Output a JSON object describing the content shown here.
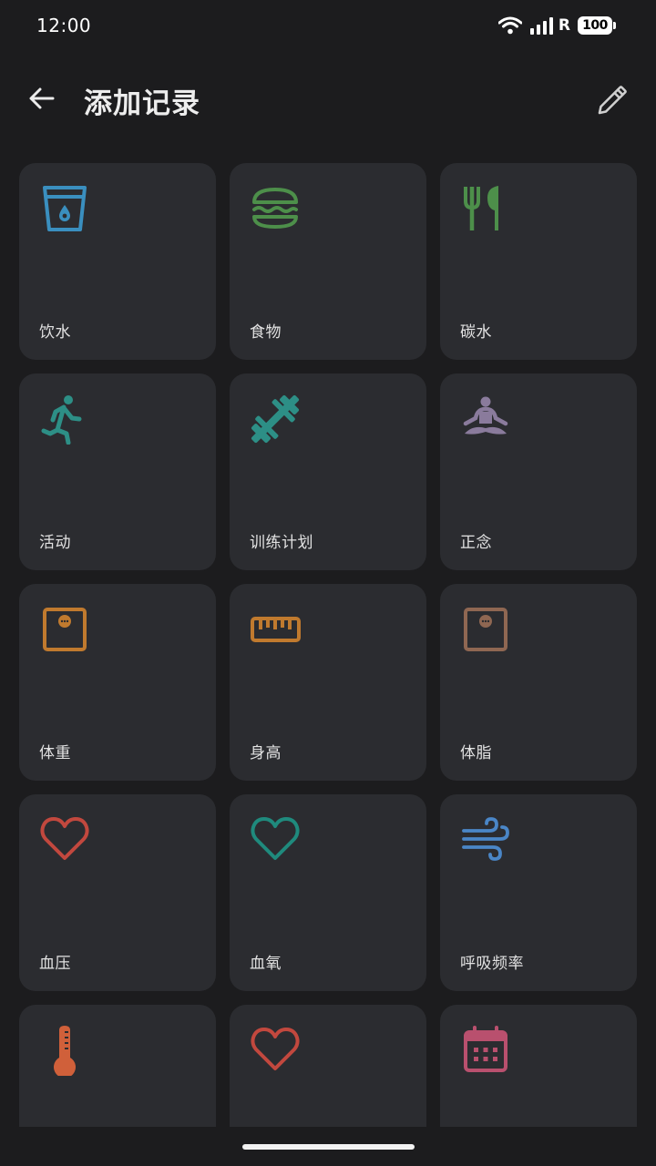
{
  "status_bar": {
    "time": "12:00",
    "network_label": "R",
    "battery": "100"
  },
  "app_bar": {
    "title": "添加记录",
    "back_icon": "arrow-back-icon",
    "edit_icon": "pencil-icon"
  },
  "tiles": [
    {
      "label": "饮水",
      "icon": "water-glass-icon",
      "color": "#3a8fbf"
    },
    {
      "label": "食物",
      "icon": "burger-icon",
      "color": "#4d8f4a"
    },
    {
      "label": "碳水",
      "icon": "fork-knife-icon",
      "color": "#4d8f4a"
    },
    {
      "label": "活动",
      "icon": "running-person-icon",
      "color": "#2d8f86"
    },
    {
      "label": "训练计划",
      "icon": "dumbbell-icon",
      "color": "#2d8f86"
    },
    {
      "label": "正念",
      "icon": "meditation-icon",
      "color": "#8a7b9c"
    },
    {
      "label": "体重",
      "icon": "scale-icon",
      "color": "#c07a2e"
    },
    {
      "label": "身高",
      "icon": "ruler-icon",
      "color": "#c07a2e"
    },
    {
      "label": "体脂",
      "icon": "scale-icon",
      "color": "#8f6752"
    },
    {
      "label": "血压",
      "icon": "heart-icon",
      "color": "#c2483e"
    },
    {
      "label": "血氧",
      "icon": "heart-icon",
      "color": "#1f8a7d"
    },
    {
      "label": "呼吸频率",
      "icon": "wind-icon",
      "color": "#4a86c7"
    },
    {
      "label": "",
      "icon": "thermometer-icon",
      "color": "#d0603a"
    },
    {
      "label": "",
      "icon": "heart-icon",
      "color": "#c2483e"
    },
    {
      "label": "",
      "icon": "calendar-icon",
      "color": "#b9506e"
    }
  ]
}
